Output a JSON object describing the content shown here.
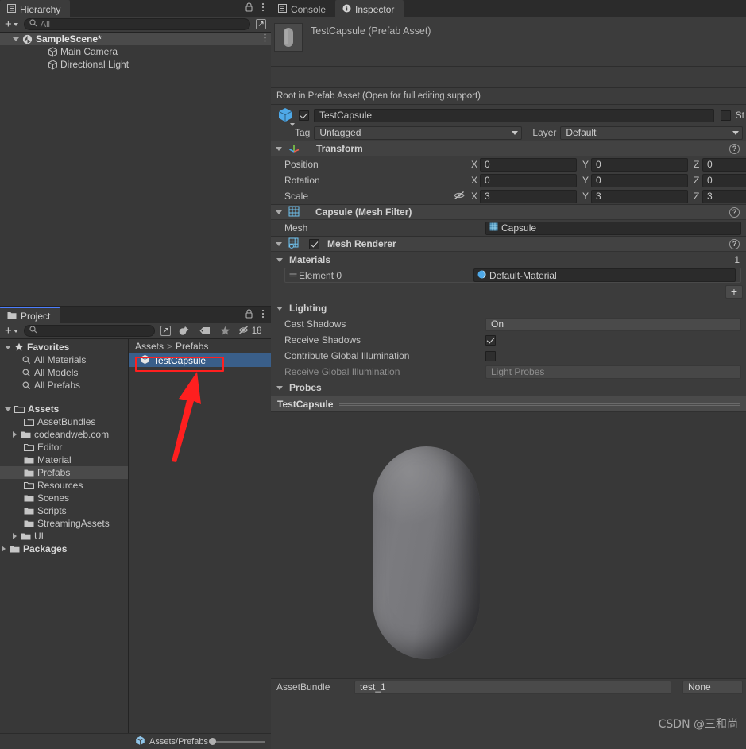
{
  "hierarchy": {
    "tab_label": "Hierarchy",
    "lock_icon": "lock-icon",
    "menu_icon": "kebab-menu-icon",
    "toolbar": {
      "add_label": "+",
      "search_placeholder": "All",
      "expand_icon": "expand-icon"
    },
    "scene": {
      "name": "SampleScene*",
      "icon": "unity-scene-icon"
    },
    "objects": [
      {
        "name": "Main Camera",
        "icon": "gameobject-cube-icon"
      },
      {
        "name": "Directional Light",
        "icon": "gameobject-cube-icon"
      }
    ]
  },
  "project": {
    "tab_label": "Project",
    "lock_icon": "lock-icon",
    "menu_icon": "kebab-menu-icon",
    "toolbar": {
      "add_label": "+",
      "search_placeholder": "",
      "expand_icon": "expand-icon",
      "material_filter_icon": "material-filter-icon",
      "label_filter_icon": "tag-label-icon",
      "favorite_icon": "star-icon",
      "hidden_icon": "eye-slash-icon",
      "hidden_count": "18"
    },
    "favorites": {
      "title": "Favorites",
      "items": [
        "All Materials",
        "All Models",
        "All Prefabs"
      ]
    },
    "assets_tree": [
      {
        "label": "Assets",
        "depth": 0,
        "expanded": true,
        "bold": true,
        "open_folder": true
      },
      {
        "label": "AssetBundles",
        "depth": 1,
        "expanded": null,
        "bold": false,
        "open_folder": true
      },
      {
        "label": "codeandweb.com",
        "depth": 1,
        "expanded": false,
        "bold": false,
        "open_folder": false
      },
      {
        "label": "Editor",
        "depth": 1,
        "expanded": null,
        "bold": false,
        "open_folder": true
      },
      {
        "label": "Material",
        "depth": 1,
        "expanded": null,
        "bold": false,
        "open_folder": false
      },
      {
        "label": "Prefabs",
        "depth": 1,
        "expanded": null,
        "bold": false,
        "open_folder": false,
        "selected": true
      },
      {
        "label": "Resources",
        "depth": 1,
        "expanded": null,
        "bold": false,
        "open_folder": true
      },
      {
        "label": "Scenes",
        "depth": 1,
        "expanded": null,
        "bold": false,
        "open_folder": false
      },
      {
        "label": "Scripts",
        "depth": 1,
        "expanded": null,
        "bold": false,
        "open_folder": false
      },
      {
        "label": "StreamingAssets",
        "depth": 1,
        "expanded": null,
        "bold": false,
        "open_folder": false
      },
      {
        "label": "UI",
        "depth": 1,
        "expanded": false,
        "bold": false,
        "open_folder": false
      },
      {
        "label": "Packages",
        "depth": 0,
        "expanded": false,
        "bold": true,
        "open_folder": false
      }
    ],
    "breadcrumb": {
      "root": "Assets",
      "separator": ">",
      "current": "Prefabs"
    },
    "content_items": [
      {
        "name": "TestCapsule",
        "icon": "prefab-cube-icon",
        "selected": true
      }
    ],
    "footer": {
      "path": "Assets/Prefabs",
      "zoom_slider_value": 0
    }
  },
  "inspector": {
    "tabs": [
      {
        "label": "Console",
        "icon": "console-icon",
        "active": false
      },
      {
        "label": "Inspector",
        "icon": "info-icon",
        "active": true
      }
    ],
    "header": {
      "title": "TestCapsule (Prefab Asset)",
      "thumbnail": "capsule-preview-thumbnail"
    },
    "prefab_note": "Root in Prefab Asset (Open for full editing support)",
    "gameobject": {
      "enabled": true,
      "name": "TestCapsule",
      "static_label": "St",
      "static_checked": false,
      "tag_label": "Tag",
      "tag_value": "Untagged",
      "layer_label": "Layer",
      "layer_value": "Default",
      "icon": "gameobject-cube-icon"
    },
    "transform": {
      "title": "Transform",
      "icon": "transform-axis-icon",
      "help_icon": "help-icon",
      "rows": [
        {
          "label": "Position",
          "x": "0",
          "y": "0",
          "z": "0"
        },
        {
          "label": "Rotation",
          "x": "0",
          "y": "0",
          "z": "0"
        },
        {
          "label": "Scale",
          "x": "3",
          "y": "3",
          "z": "3",
          "constrain_icon": "unlink-scale-icon"
        }
      ],
      "axis_x": "X",
      "axis_y": "Y",
      "axis_z": "Z"
    },
    "mesh_filter": {
      "title": "Capsule (Mesh Filter)",
      "icon": "mesh-filter-icon",
      "help_icon": "help-icon",
      "mesh_label": "Mesh",
      "mesh_value": "Capsule",
      "mesh_value_icon": "mesh-icon"
    },
    "mesh_renderer": {
      "title": "Mesh Renderer",
      "icon": "mesh-renderer-icon",
      "enabled": true,
      "help_icon": "help-icon",
      "materials": {
        "title": "Materials",
        "count": "1",
        "elements": [
          {
            "label": "Element 0",
            "value": "Default-Material",
            "value_icon": "material-sphere-icon"
          }
        ],
        "add_label": "+"
      },
      "lighting": {
        "title": "Lighting",
        "cast_shadows_label": "Cast Shadows",
        "cast_shadows_value": "On",
        "receive_shadows_label": "Receive Shadows",
        "receive_shadows_checked": true,
        "contribute_gi_label": "Contribute Global Illumination",
        "contribute_gi_checked": false,
        "receive_gi_label": "Receive Global Illumination",
        "receive_gi_value": "Light Probes"
      },
      "probes": {
        "title": "Probes"
      }
    },
    "preview": {
      "title": "TestCapsule",
      "object": "capsule-3d-preview"
    },
    "asset_bundle": {
      "label": "AssetBundle",
      "value": "test_1",
      "variant_value": "None"
    }
  },
  "annotations": {
    "highlight_rect": "red-highlight-box",
    "arrow": "red-arrow-pointer",
    "watermark": "CSDN @三和尚",
    "accent_color": "#ff1f1f",
    "selection_color": "#3a5f8a"
  }
}
